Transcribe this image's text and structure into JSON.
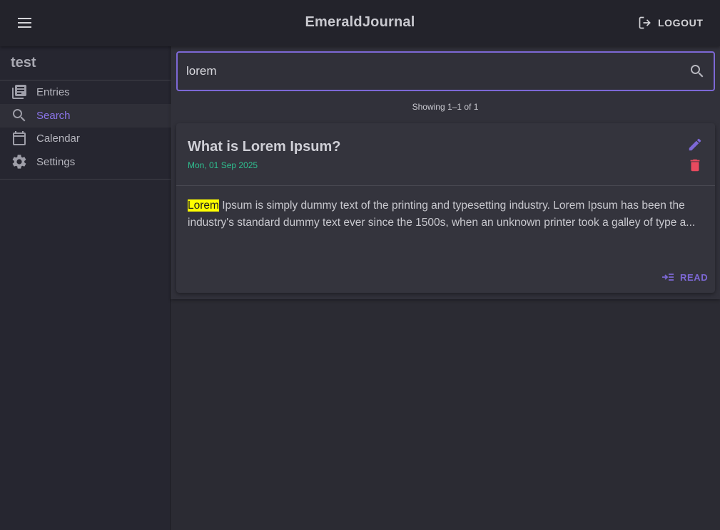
{
  "app": {
    "title": "EmeraldJournal"
  },
  "header": {
    "logout_label": "LOGOUT"
  },
  "sidebar": {
    "user": "test",
    "items": [
      {
        "label": "Entries",
        "icon": "book-icon",
        "active": false
      },
      {
        "label": "Search",
        "icon": "search-icon",
        "active": true
      },
      {
        "label": "Calendar",
        "icon": "calendar-icon",
        "active": false
      },
      {
        "label": "Settings",
        "icon": "gear-icon",
        "active": false
      }
    ]
  },
  "search": {
    "value": "lorem",
    "placeholder": ""
  },
  "results": {
    "count_text": "Showing 1–1 of 1",
    "entries": [
      {
        "title": "What is Lorem Ipsum?",
        "date": "Mon, 01 Sep 2025",
        "highlight": "Lorem",
        "excerpt_rest": " Ipsum is simply dummy text of the printing and typesetting industry. Lorem Ipsum has been the industry's standard dummy text ever since the 1500s, when an unknown printer took a galley of type a...",
        "read_label": "READ"
      }
    ]
  },
  "colors": {
    "accent": "#7d68d6",
    "date": "#2fbf8f",
    "delete": "#e84a5f",
    "highlight": "#ffff00"
  }
}
